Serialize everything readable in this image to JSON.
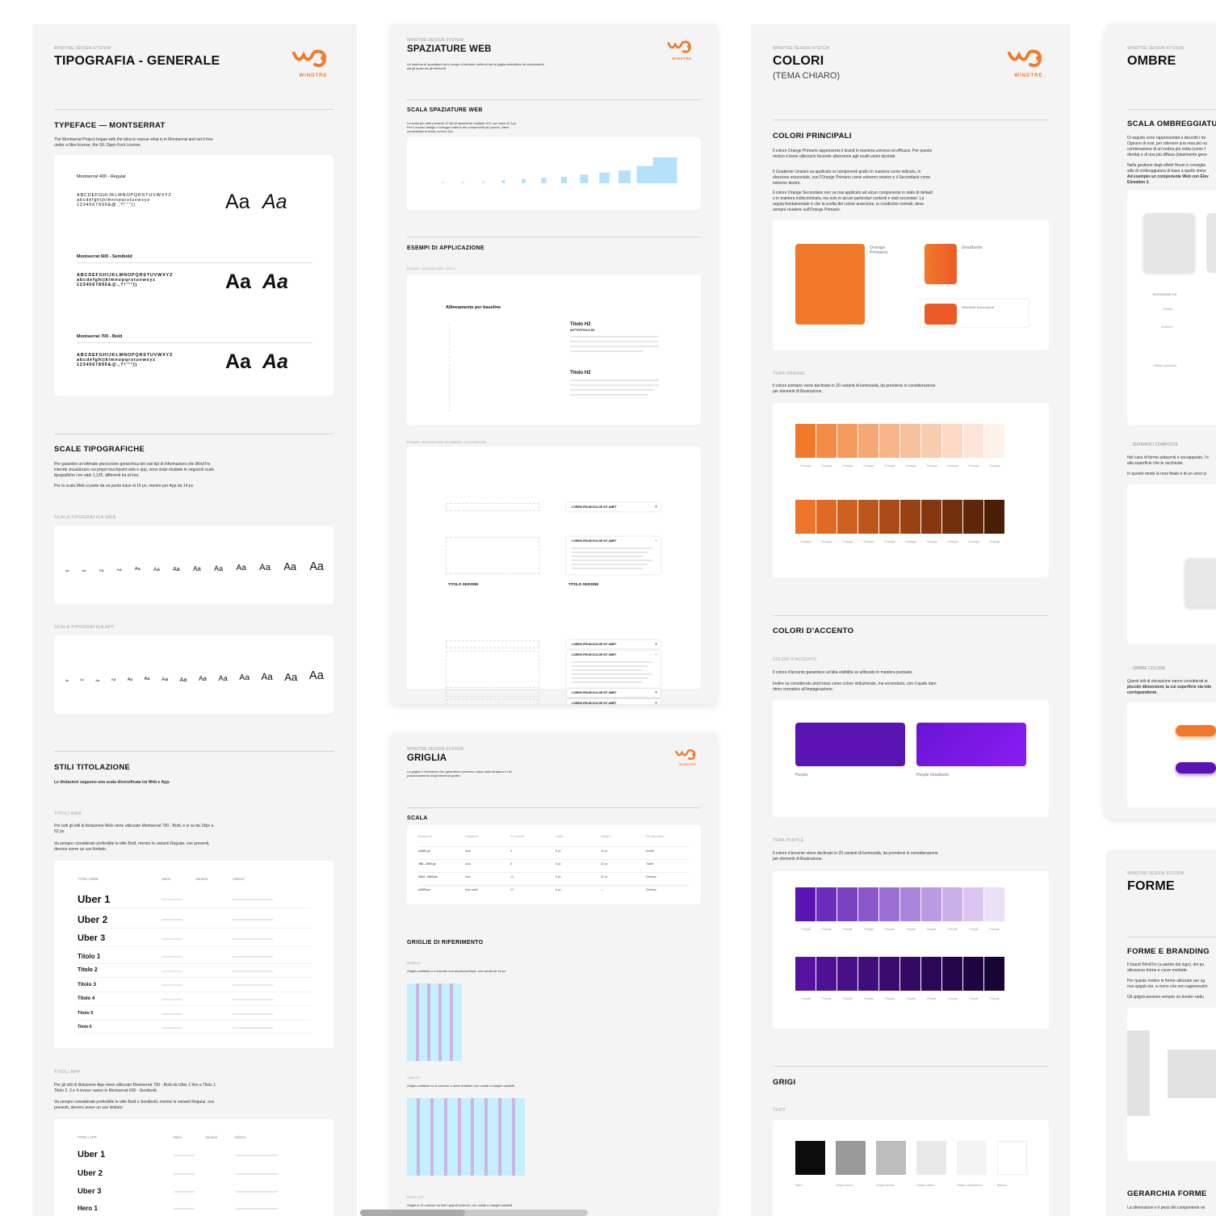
{
  "brand": {
    "logo_word": "WINDTRE",
    "kicker": "WINDTRE DESIGN SYSTEM",
    "accent": "#f07a2a",
    "purple": "#5a14b4"
  },
  "tipografia": {
    "title": "TIPOGRAFIA - GENERALE",
    "typeface_heading": "TYPEFACE — MONTSERRAT",
    "typeface_body": "The Montserrat Project began with the idea to rescue what is in Montserrat and set it free under a libre license, the SIL Open Font License.",
    "weights": [
      {
        "label": "Montserrat 400 - Regular",
        "upper": "ABCDEFGHIJKLMNOPQRSTUVWXYZ",
        "lower": "abcdefghijklmnopqrstuvwxyz",
        "digits": "1234567890&@.,?!'\"\"()",
        "sample": "Aa",
        "sample_italic": "Aa"
      },
      {
        "label": "Montserrat 600 - Semibold",
        "upper": "ABCDEFGHIJKLMNOPQRSTUVWXYZ",
        "lower": "abcdefghijklmnopqrstuvwxyz",
        "digits": "1234567890&@.,?!'\"\"()",
        "sample": "Aa",
        "sample_italic": "Aa"
      },
      {
        "label": "Montserrat 700 - Bold",
        "upper": "ABCDEFGHIJKLMNOPQRSTUVWXYZ",
        "lower": "abcdefghijklmnopqrstuvwxyz",
        "digits": "1234567890&@.,?!'\"\"()",
        "sample": "Aa",
        "sample_italic": "Aa"
      }
    ],
    "scale_heading": "SCALE TIPOGRAFICHE",
    "scale_body_1": "Per garantire un'ottimale percezione gerarchica dei vari tipi di informazioni che WindTre intende visualizzare sui propri touchpoint web e app, sono state studiate le seguenti scale tipografiche con ratio 1,125, differenti tra di loro.",
    "scale_body_2": "Per la scala Web si parte da un punto base di 16 px, mentre per App da 14 px.",
    "scale_web_caption": "SCALA TIPOGRAFICA WEB",
    "scale_app_caption": "SCALA TIPOGRAFICA APP",
    "scale_sample": "Aa",
    "titles_heading": "STILI TITOLAZIONE",
    "titles_body": "Le titolazioni seguono una scala diversificata tra Web e App.",
    "titoli_web_caption": "TITOLI WEB",
    "titoli_web_body_1": "Per tutti gli stili di titolazione Web viene utilizzato Montserrat 700 - Bold, e si va da 18px a 52 px.",
    "titoli_web_body_2": "Va sempre considerato preferibile lo stile Bold, mentre le varianti Regular, ove presenti, devono avere un uso limitato.",
    "web_table_headers": [
      "TITOLI WEB",
      "Valori",
      "Varianti",
      "Utilizzo"
    ],
    "web_titles": [
      "Uber 1",
      "Uber 2",
      "Uber 3",
      "Titolo 1",
      "Titolo 2",
      "Titolo 3",
      "Titolo 4",
      "Titolo 5",
      "Titolo 6"
    ],
    "titoli_app_caption": "TITOLI APP",
    "titoli_app_body_1": "Per gli stili di titolazione App viene utilizzato Montserrat 700 - Bold da Uber 1 fino a Titolo 1. Titolo 2, 3 e 4 invece vanno in Montserrat 600 - Semibold.",
    "titoli_app_body_2": "Va sempre considerato preferibile lo stile Bold o Semibold, mentre le varianti Regular, ove presenti, devono avere un uso limitato.",
    "app_table_headers": [
      "TITOLI APP",
      "Valori",
      "Varianti",
      "Utilizzo"
    ],
    "app_titles": [
      "Uber 1",
      "Uber 2",
      "Uber 3",
      "Hero 1"
    ]
  },
  "spaziature": {
    "title": "SPAZIATURE WEB",
    "body": "Un sistema di spaziature ha lo scopo di rendere uniformi sia la griglia costruttiva dei componenti sia gli spazi tra gli elementi.",
    "scale_heading": "SCALA SPAZIATURE WEB",
    "scale_body": "La scala per web prevede 12 tipi di spaziature multiple di 8, con base di 4 px. Per il mondo design e sviluppo interno dei componenti più piccoli, viene considerata la metà, ovvero 2px.",
    "bars": [
      1,
      2,
      4,
      6,
      8,
      10,
      12,
      16,
      20,
      24,
      32,
      48
    ],
    "examples_heading": "ESEMPI DI APPLICAZIONE",
    "examples_text_caption": "ESEMPI SPAZIATURE TESTI",
    "baseline_title": "Allineamento per baseline",
    "titolo_h2": "Titolo H2",
    "sottotitolo": "SOTTOTITOLO H3",
    "examples_accordion_caption": "ESEMPI SPAZIATURE ELEMENTI ACCORDION",
    "accordion_label": "LOREM IPSUM DOLOR SIT AMET",
    "titolo_sezione": "TITOLO SEZIONE"
  },
  "griglia": {
    "title": "GRIGLIA",
    "body": "La griglia è l'elemento che garantisce coerenza visiva nella struttura e nel posizionamento degli elementi grafici.",
    "scala_heading": "SCALA",
    "table_headers": [
      "Breakpoint",
      "Larghezza",
      "N. Colonne",
      "Gutter",
      "Margini",
      "Per dispositivo"
    ],
    "rows": [
      [
        "≥1921 px",
        "Auto",
        "6",
        "8 px",
        "16 px",
        "Mobile"
      ],
      [
        "768 - 1920 px",
        "Auto",
        "8",
        "8 px",
        "32 px",
        "Tablet"
      ],
      [
        "1024 - 1920 px",
        "Auto",
        "12",
        "8 px",
        "32 px",
        "Desktop"
      ],
      [
        "≥1920 px",
        "Max width",
        "12",
        "8 px",
        "—",
        "Desktop"
      ]
    ],
    "riferimento_heading": "GRIGLIE DI RIFERIMENTO",
    "mobile_caption": "MOBILE",
    "mobile_body": "Griglia costituita a 4 colonne con ampiezza fissa, con canali da 16 px.",
    "tablet_caption": "TABLET",
    "tablet_body": "Griglia costituita su 8 colonne a metà di tablet, con canali a margini variabili.",
    "desktop_caption": "DESKTOP",
    "desktop_body": "Griglia a 12 colonne su tutti i grandi schermi, con canali a margini variabili."
  },
  "colori": {
    "title": "COLORI",
    "subtitle": "(TEMA CHIARO)",
    "principali_heading": "COLORI PRINCIPALI",
    "principali_body_1": "Il colore Orange Primario rappresenta il brand in maniera univoca ed efficace. Per questo motivo è bene utilizzarlo facendo attenzione agli esatti valori riportati.",
    "principali_body_2": "Il Gradiente Unsiaro va applicato ai componenti grafici in maniera come indicato, in direzione orizzontale, con l'Orange Primario come estremo sinistro e il Secondario come estremo destro.",
    "principali_body_3": "Il colore Orange Secondario non va mai applicato ad alcun componente in stato di default o in maniera indiscriminata, ma solo in alcuni particolari contesti e stati secondari. La regola fondamentale è che la scelta del colore arancione, in condizioni normali, deve sempre ricadere sull'Orange Primario.",
    "orange_primario": "Orange Primario",
    "gradiente": "Gradiente",
    "orange_secondario": "ORANGE Secondario",
    "tema_orange_caption": "TEMA ORANGE",
    "tema_orange_body": "Il colore primario viene declinato in 20 varianti di luminosità, da prendersi in considerazione per elementi di illustrazione.",
    "orange_light": [
      "#f07a2a",
      "#f38c46",
      "#f49c5e",
      "#f5a873",
      "#f6b488",
      "#f8c09c",
      "#f9ccb0",
      "#fbd9c5",
      "#fce5d8",
      "#fdf1ea"
    ],
    "orange_dark": [
      "#ee7429",
      "#e06a24",
      "#cf6020",
      "#bd561c",
      "#ab4c18",
      "#984214",
      "#853810",
      "#722f0c",
      "#5f2609",
      "#4a1d06"
    ],
    "orange_label": "Orange",
    "accento_heading": "COLORI D'ACCENTO",
    "accento_caption": "COLORI D'ACCENTO",
    "accento_body_1": "Il colore d'accento garantisce un'alta visibilità se utilizzato in maniera puntuale.",
    "accento_body_2": "Inoltre va considerato anch'esso come colore istituzionale, ma secondario, con il quale dare ritmo cromatico all'impaginazione.",
    "purple": "Purple",
    "purple_gradiente": "Purple Gradiente",
    "tema_purple_caption": "TEMA PURPLE",
    "tema_purple_body": "Il colore d'accento viene declinato in 20 varianti di luminosità, da prendersi in considerazione per elementi di illustrazione.",
    "purple_light": [
      "#5a14b4",
      "#6a2dbb",
      "#7a42c3",
      "#8a58cb",
      "#9a6ed3",
      "#aa84da",
      "#ba9ae2",
      "#cab0e9",
      "#dac6f1",
      "#eae0f8"
    ],
    "purple_dark": [
      "#54129f",
      "#4e1094",
      "#480e88",
      "#410c7c",
      "#3a0a70",
      "#330964",
      "#2c0758",
      "#25064c",
      "#1e0440",
      "#170334"
    ],
    "purple_label": "Purple",
    "grigi_heading": "GRIGI",
    "testi_caption": "TESTI",
    "greys": [
      "#0c0c0c",
      "#999999",
      "#bdbdbd",
      "#e9e9e9",
      "#f4f4f4",
      "#ffffff"
    ],
    "grey_labels": [
      "Nero",
      "Grigio scuro",
      "Grigio medio",
      "Grigio chiaro",
      "Grigio chiarissimo",
      "Bianco"
    ]
  },
  "ombre": {
    "title": "OMBRE",
    "scala_heading": "SCALA OMBREGGIATU",
    "body_1": "Di seguito sono rappresentati e descritti i tre",
    "body_2": "Ognuno di essi, per ottenere una resa più na",
    "body_3": "combinazione di un'ombra più netta (come f",
    "body_4": "diretta) e di una più diffusa (idealmente gene",
    "body_5": "Nella gestione degli effetti Hover è consiglia",
    "body_6": "stile di ombreggiatura di base a quello imme",
    "body_7": "Ad esempio un componente Web con Elev",
    "body_8": "Elevation 3.",
    "elevation": "ELEVATION 0.5",
    "diretta": "Diretta",
    "ambient": "Ambient",
    "utilizzo": "Utilizzo (limitato)",
    "superfici": "SUPERFICI COMPOSTE",
    "superfici_body_1": "Nel caso di forme adiacenti e sovrapposte, l'o",
    "superfici_body_2": "alla superficie che le racchiude.",
    "superfici_body_3": "In questo modo la resa finale è di un unico p",
    "ombre_colore": "OMBRE COLORE",
    "ombre_colore_body_1": "Questi stili di elevazione vanno considerati er",
    "ombre_colore_body_2": "piccole dimensioni, la cui superficie sia inte",
    "ombre_colore_body_3": "corrispondente."
  },
  "forme": {
    "title": "FORME",
    "branding_heading": "FORME E BRANDING",
    "body_1": "Il brand WindTre (a partire dal logo), del pu",
    "body_2": "attraverso forme e curve morbide.",
    "body_3": "Per questo motivo le forme utilizzate per og",
    "body_4": "mai spigoli vivi, a meno che non ragionevolm",
    "body_5": "Gli spigoli avranno sempre un border-radiu",
    "gerarchia_heading": "GERARCHIA FORME",
    "gerarchia_body": "La dimensione e il peso del componente ne"
  }
}
